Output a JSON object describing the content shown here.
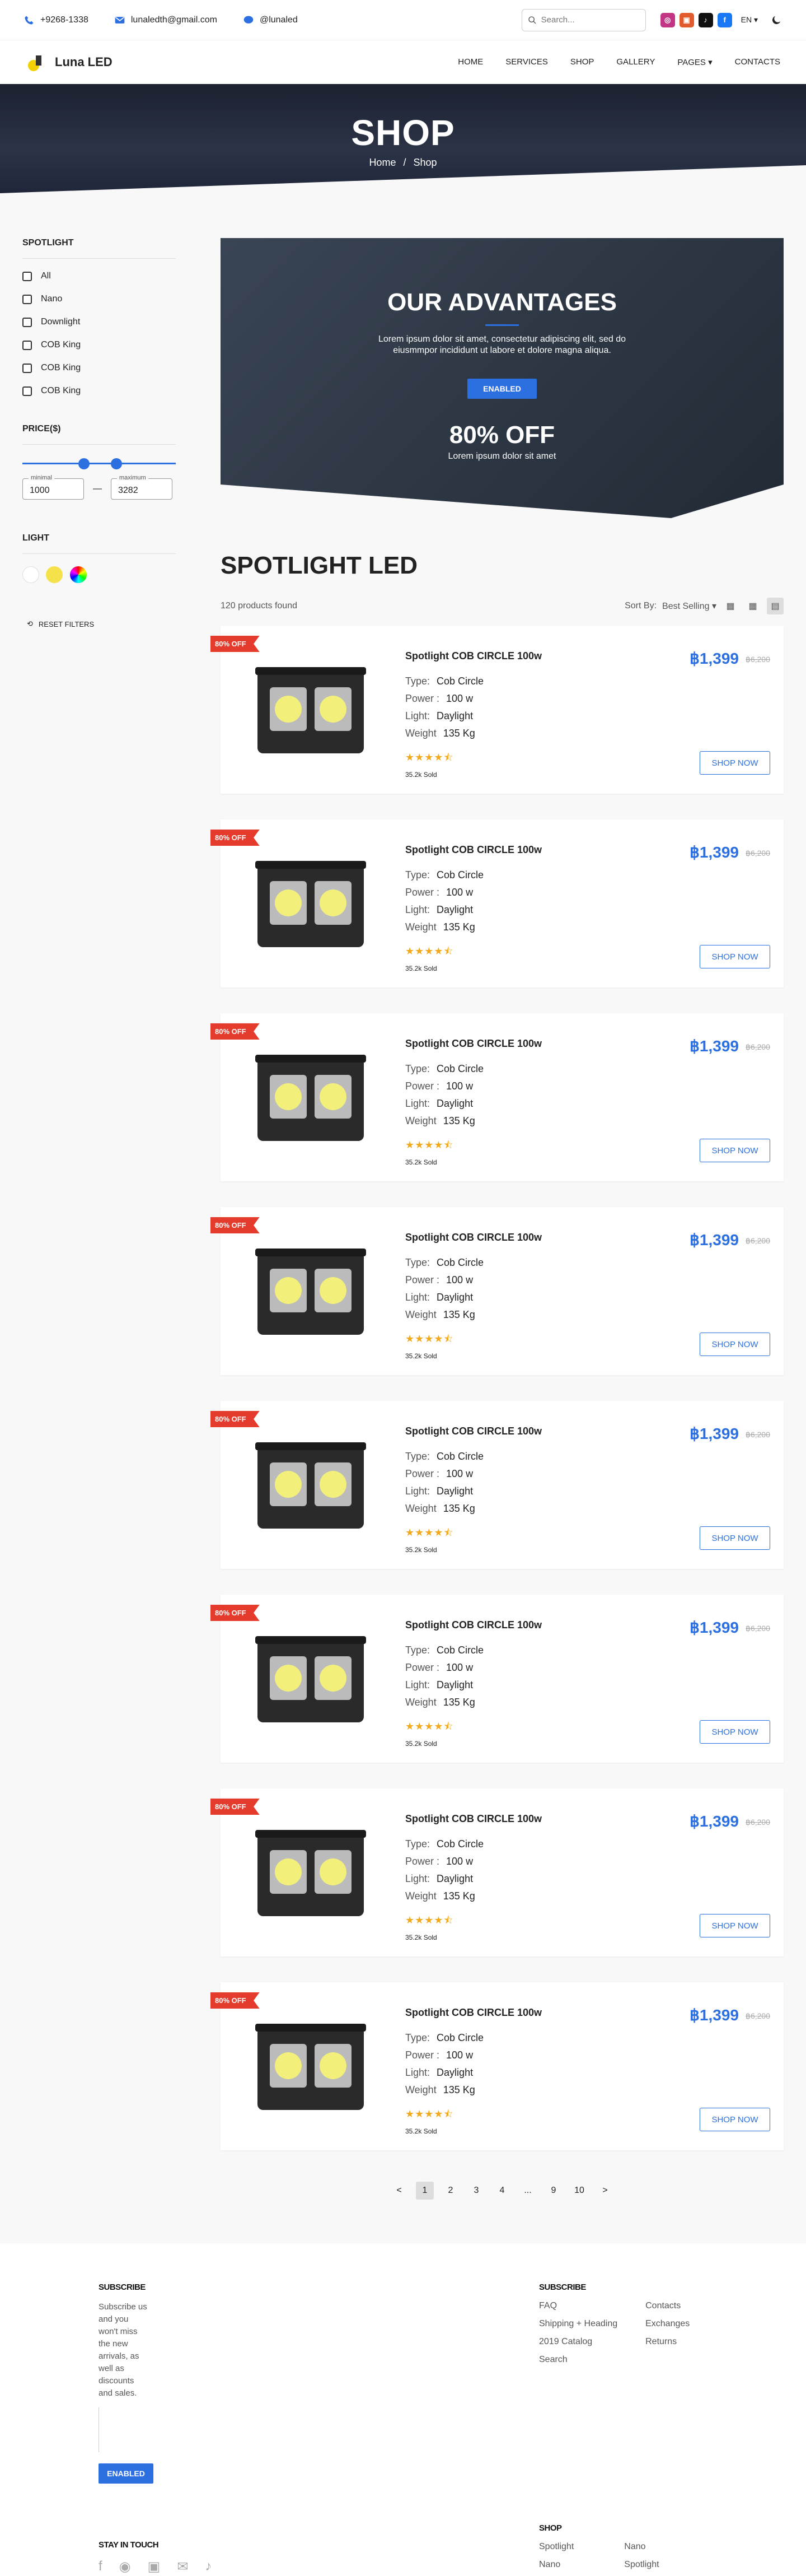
{
  "topbar": {
    "phone": "+9268-1338",
    "email": "lunaledth@gmail.com",
    "line": "@lunaled",
    "search_placeholder": "Search...",
    "lang": "EN"
  },
  "navbar": {
    "brand": "Luna LED",
    "items": [
      {
        "label": "HOME"
      },
      {
        "label": "SERVICES"
      },
      {
        "label": "SHOP"
      },
      {
        "label": "GALLERY"
      },
      {
        "label": "PAGES"
      },
      {
        "label": "CONTACTS"
      }
    ]
  },
  "hero": {
    "title": "SHOP",
    "crumb_home": "Home",
    "crumb_sep": "/",
    "crumb_current": "Shop"
  },
  "sidebar": {
    "spotlight_title": "SPOTLIGHT",
    "spotlight_items": [
      "All",
      "Nano",
      "Downlight",
      "COB King",
      "COB King",
      "COB King"
    ],
    "price_title": "PRICE($)",
    "min_label": "minimal",
    "max_label": "maximum",
    "min_value": "1000",
    "max_value": "3282",
    "light_title": "LIGHT",
    "reset": "RESET FILTERS"
  },
  "banner": {
    "title": "OUR ADVANTAGES",
    "text": "Lorem ipsum dolor sit amet, consectetur adipiscing elit, sed do eiusmmpor incididunt ut labore et dolore magna aliqua.",
    "button": "ENABLED",
    "discount": "80% OFF",
    "subtext": "Lorem ipsum dolor sit amet"
  },
  "listing": {
    "title": "SPOTLIGHT LED",
    "count": "120 products found",
    "sort_label": "Sort By:",
    "sort_value": "Best Selling"
  },
  "product": {
    "badge": "80% OFF",
    "name": "Spotlight COB CIRCLE 100w",
    "type_label": "Type:",
    "type": "Cob Circle",
    "power_label": "Power :",
    "power": "100 w",
    "light_label": "Light:",
    "light": "Daylight",
    "weight_label": "Weight",
    "weight": "135 Kg",
    "rating": 4.5,
    "sold": "35.2k Sold",
    "price": "฿1,399",
    "old_price": "฿6,200",
    "button": "SHOP NOW"
  },
  "pagination": [
    "<",
    "1",
    "2",
    "3",
    "4",
    "...",
    "9",
    "10",
    ">"
  ],
  "footer": {
    "subscribe_title": "SUBSCRIBE",
    "subscribe_text": "Subscribe us and you won't miss the new arrivals, as well as discounts and sales.",
    "subscribe_button": "ENABLED",
    "col_title": "SUBSCRIBE",
    "links_a": [
      "FAQ",
      "Shipping + Heading",
      "2019 Catalog",
      "Search"
    ],
    "links_b": [
      "Contacts",
      "Exchanges",
      "Returns"
    ],
    "stay_title": "STAY IN TOUCH",
    "shop_title": "SHOP",
    "shop_a": [
      "Spotlight",
      "Nano"
    ],
    "shop_b": [
      "Nano",
      "Spotlight"
    ]
  }
}
